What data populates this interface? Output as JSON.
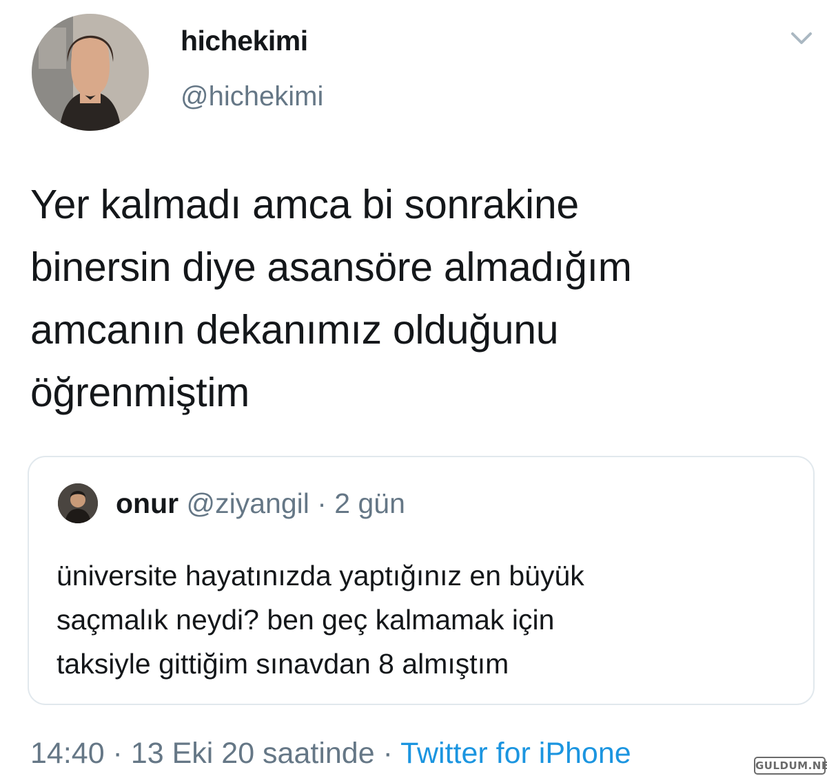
{
  "author": {
    "display_name": "hichekimi",
    "handle": "@hichekimi",
    "avatar_icon": "user-avatar"
  },
  "menu": {
    "icon": "chevron-down-icon"
  },
  "tweet": {
    "text": "Yer kalmadı amca bi sonrakine\nbinersin diye asansöre almadığım\namcanın dekanımız olduğunu\nöğrenmiştim"
  },
  "quoted_tweet": {
    "display_name": "onur",
    "handle": "@ziyangil",
    "separator": " · ",
    "age": "2 gün",
    "text": "üniversite hayatınızda yaptığınız en büyük\nsaçmalık neydi? ben geç kalmamak için\ntaksiyle gittiğim sınavdan 8 almıştım"
  },
  "footer": {
    "timestamp": "14:40 · 13 Eki 20 saatinde · ",
    "source": "Twitter for iPhone"
  },
  "watermark": {
    "text": "GULDUM.NET"
  },
  "colors": {
    "text": "#14171a",
    "muted": "#657786",
    "link": "#1b95e0",
    "border": "#e1e8ed"
  }
}
